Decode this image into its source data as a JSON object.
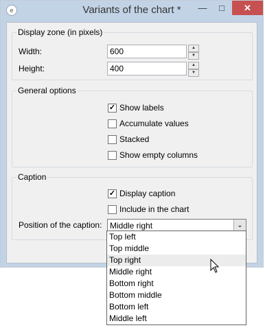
{
  "window": {
    "title": "Variants of the chart *",
    "icons": {
      "app": "app-icon",
      "minimize": "minimize-icon",
      "maximize": "maximize-icon",
      "close": "close-icon"
    }
  },
  "display_zone": {
    "legend": "Display zone (in pixels)",
    "width_label": "Width:",
    "width_value": "600",
    "height_label": "Height:",
    "height_value": "400"
  },
  "general_options": {
    "legend": "General options",
    "show_labels": {
      "label": "Show labels",
      "checked": true
    },
    "accumulate_values": {
      "label": "Accumulate values",
      "checked": false
    },
    "stacked": {
      "label": "Stacked",
      "checked": false
    },
    "show_empty_columns": {
      "label": "Show empty columns",
      "checked": false
    }
  },
  "caption": {
    "legend": "Caption",
    "display_caption": {
      "label": "Display caption",
      "checked": true
    },
    "include_in_chart": {
      "label": "Include in the chart",
      "checked": false
    },
    "position_label": "Position of the caption:",
    "position_value": "Middle right",
    "options": [
      "Top left",
      "Top middle",
      "Top right",
      "Middle right",
      "Bottom right",
      "Bottom middle",
      "Bottom left",
      "Middle left"
    ],
    "hovered_option": "Top right"
  },
  "colors": {
    "close_button": "#c75050",
    "title_bar": "#c3d3e6",
    "client": "#f0f0f0"
  }
}
